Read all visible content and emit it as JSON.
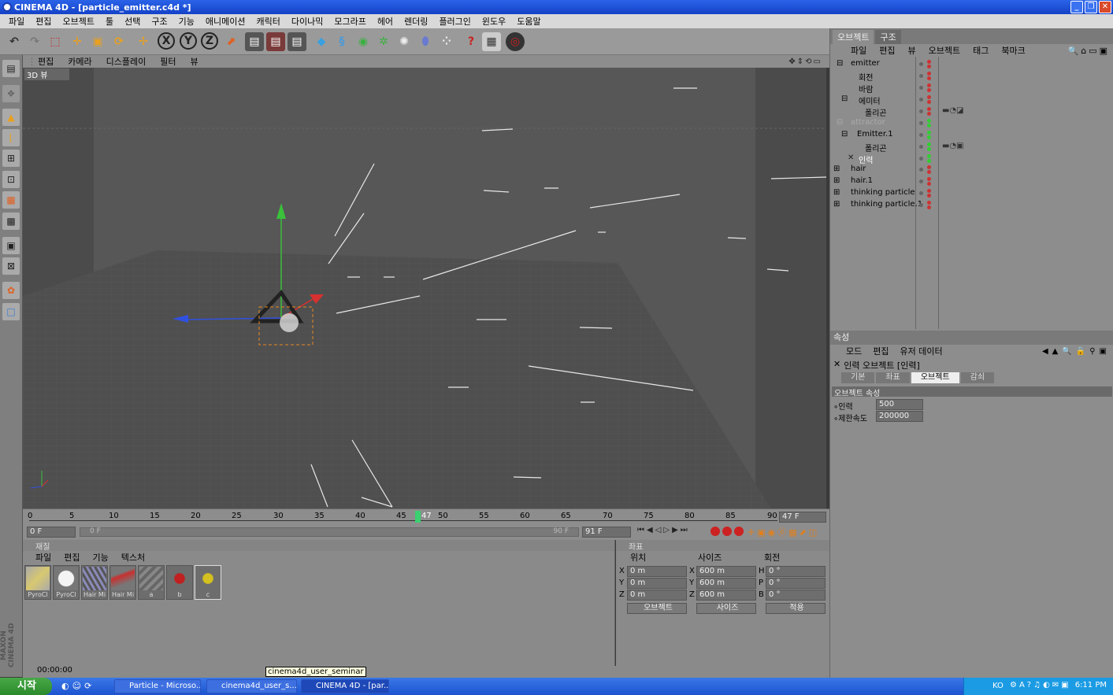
{
  "window": {
    "title": "CINEMA 4D - [particle_emitter.c4d *]"
  },
  "menubar": [
    "파일",
    "편집",
    "오브젝트",
    "툴",
    "선택",
    "구조",
    "기능",
    "애니메이션",
    "캐릭터",
    "다이나믹",
    "모그라프",
    "헤어",
    "렌더링",
    "플러그인",
    "윈도우",
    "도움말"
  ],
  "viewport": {
    "menu": [
      "편집",
      "카메라",
      "디스플레이",
      "필터",
      "뷰"
    ],
    "label": "3D 뷰"
  },
  "timeline": {
    "ticks": [
      "0",
      "5",
      "10",
      "15",
      "20",
      "25",
      "30",
      "35",
      "40",
      "45",
      "50",
      "55",
      "60",
      "65",
      "70",
      "75",
      "80",
      "85",
      "90"
    ],
    "current_marker": "47",
    "current_frame_field": "47 F",
    "start_field": "0 F",
    "slider_left": "0 F",
    "slider_right": "90 F",
    "end_field": "91 F"
  },
  "materials": {
    "header": "재질",
    "menu": [
      "파일",
      "편집",
      "기능",
      "텍스처"
    ],
    "items": [
      {
        "name": "PyroCl",
        "color": "#d8c870"
      },
      {
        "name": "PyroCl",
        "color": "#f4f4f4"
      },
      {
        "name": "Hair Mi",
        "color": "#8a8ab8"
      },
      {
        "name": "Hair Mi",
        "color": "#c83030"
      },
      {
        "name": "a",
        "color": "#7a7a7a"
      },
      {
        "name": "b",
        "color": "#c02020"
      },
      {
        "name": "c",
        "color": "#d4c020"
      }
    ]
  },
  "coordinates": {
    "header": "좌표",
    "columns": [
      "위치",
      "사이즈",
      "회전"
    ],
    "rows": [
      {
        "axis": "X",
        "pos": "0 m",
        "size_axis": "X",
        "size": "600 m",
        "rot_axis": "H",
        "rot": "0 °"
      },
      {
        "axis": "Y",
        "pos": "0 m",
        "size_axis": "Y",
        "size": "600 m",
        "rot_axis": "P",
        "rot": "0 °"
      },
      {
        "axis": "Z",
        "pos": "0 m",
        "size_axis": "Z",
        "size": "600 m",
        "rot_axis": "B",
        "rot": "0 °"
      }
    ],
    "mode_select": "오브젝트",
    "size_select": "사이즈",
    "apply_button": "적용"
  },
  "status": {
    "time": "00:00:00"
  },
  "object_manager": {
    "tabs": [
      "오브젝트",
      "구조"
    ],
    "menu": [
      "파일",
      "편집",
      "뷰",
      "오브젝트",
      "태그",
      "북마크"
    ],
    "objects": [
      {
        "name": "emitter",
        "indent": 0
      },
      {
        "name": "회전",
        "indent": 1
      },
      {
        "name": "바람",
        "indent": 1
      },
      {
        "name": "에미터",
        "indent": 1
      },
      {
        "name": "폴리곤",
        "indent": 2
      },
      {
        "name": "attractor",
        "indent": 0
      },
      {
        "name": "Emitter.1",
        "indent": 1
      },
      {
        "name": "폴리곤",
        "indent": 2
      },
      {
        "name": "인력",
        "indent": 1
      },
      {
        "name": "hair",
        "indent": 0
      },
      {
        "name": "hair.1",
        "indent": 0
      },
      {
        "name": "thinking particle",
        "indent": 0
      },
      {
        "name": "thinking particle.1",
        "indent": 0
      }
    ]
  },
  "attributes": {
    "header": "속성",
    "menu": [
      "모드",
      "편집",
      "유저 데이터"
    ],
    "object_title": "인력 오브젝트 [인력]",
    "tabs": [
      "기본",
      "좌표",
      "오브젝트",
      "감쇠"
    ],
    "active_tab": "오브젝트",
    "section": "오브젝트 속성",
    "fields": [
      {
        "label": "인력",
        "value": "500"
      },
      {
        "label": "제한속도",
        "value": "200000"
      }
    ]
  },
  "taskbar": {
    "start": "시작",
    "tasks": [
      "Particle - Microso...",
      "cinema4d_user_s...",
      "CINEMA 4D - [par..."
    ],
    "tray_lang": "KO",
    "clock": "6:11 PM"
  },
  "tooltip": "cinema4d_user_seminar"
}
